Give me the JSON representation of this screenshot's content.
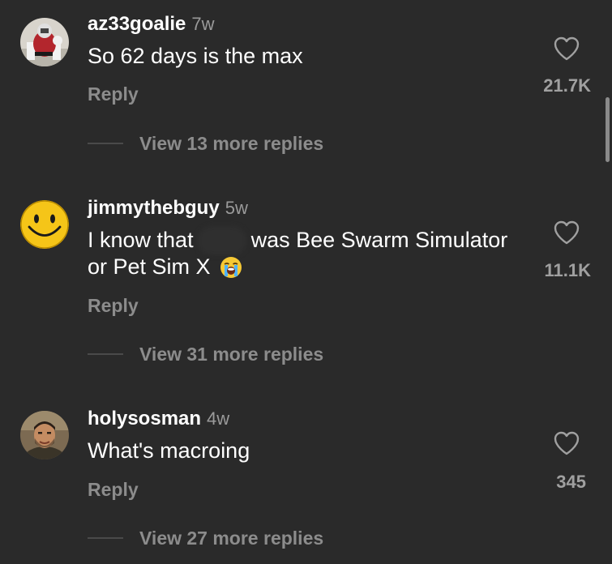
{
  "comments": [
    {
      "username": "az33goalie",
      "time": "7w",
      "text": "So 62 days is the max",
      "reply_label": "Reply",
      "likes": "21.7K",
      "view_more": "View 13 more replies",
      "avatar_icon": "hockey-goalie-avatar"
    },
    {
      "username": "jimmythebguy",
      "time": "5w",
      "text_part1": "I know that",
      "text_part2": "was Bee Swarm Simulator or Pet Sim X",
      "emoji_icon": "loudly-crying-face-emoji",
      "reply_label": "Reply",
      "likes": "11.1K",
      "view_more": "View 31 more replies",
      "avatar_icon": "smiley-face-avatar"
    },
    {
      "username": "holysosman",
      "time": "4w",
      "text": "What's macroing",
      "reply_label": "Reply",
      "likes": "345",
      "view_more": "View 27 more replies",
      "avatar_icon": "man-photo-avatar"
    }
  ],
  "colors": {
    "background": "#2a2a2a",
    "username": "#ffffff",
    "secondary_text": "#8c8c8c",
    "smiley": "#f5c518"
  }
}
